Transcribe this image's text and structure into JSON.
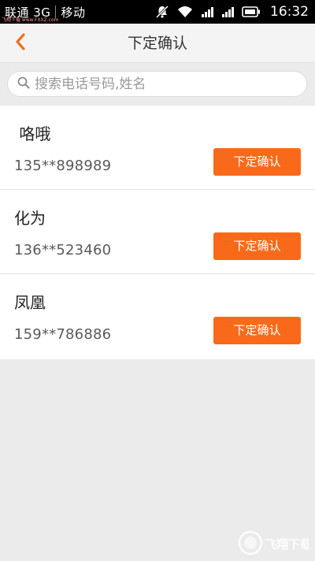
{
  "status_bar": {
    "carrier_left": "联通 3G",
    "carrier_right": "移动",
    "time": "16:32",
    "watermark": "飞翔下载 www.FXXZ.com",
    "icons": [
      "mute-icon",
      "wifi-icon",
      "signal-icon",
      "signal-icon",
      "battery-icon"
    ]
  },
  "header": {
    "title": "下定确认",
    "back_icon": "chevron-left-icon",
    "accent_color": "#f86a1a"
  },
  "search": {
    "placeholder": "搜索电话号码,姓名",
    "icon": "search-icon"
  },
  "contacts": [
    {
      "name": " 咯哦",
      "phone": "135**898989",
      "button": "下定确认"
    },
    {
      "name": "化为",
      "phone": "136**523460",
      "button": "下定确认"
    },
    {
      "name": "凤凰",
      "phone": "159**786886",
      "button": "下定确认"
    }
  ],
  "watermark_br": "飞翔下载"
}
